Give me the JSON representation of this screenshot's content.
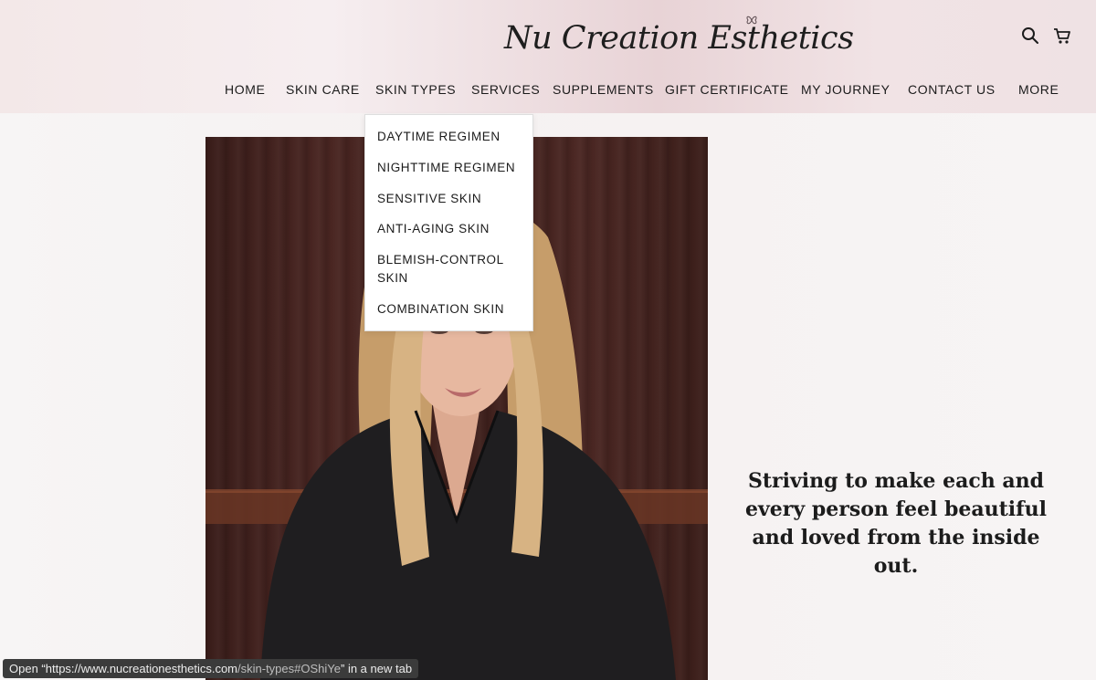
{
  "brand": {
    "logo_text": "Nu Creation Esthetics"
  },
  "header": {
    "icons": [
      "search-icon",
      "cart-icon"
    ]
  },
  "nav": {
    "items": [
      {
        "label": "HOME"
      },
      {
        "label": "SKIN CARE"
      },
      {
        "label": "SKIN TYPES"
      },
      {
        "label": "SERVICES"
      },
      {
        "label": "SUPPLEMENTS"
      },
      {
        "label": "GIFT CERTIFICATE"
      },
      {
        "label": "MY JOURNEY"
      },
      {
        "label": "CONTACT US"
      },
      {
        "label": "MORE"
      }
    ]
  },
  "dropdown": {
    "items": [
      {
        "label": "DAYTIME REGIMEN"
      },
      {
        "label": "NIGHTTIME REGIMEN"
      },
      {
        "label": "SENSITIVE SKIN"
      },
      {
        "label": "ANTI-AGING SKIN"
      },
      {
        "label": "BLEMISH-CONTROL SKIN"
      },
      {
        "label": "COMBINATION SKIN"
      }
    ]
  },
  "hero": {
    "tagline": "Striving to make each and every person feel beautiful and loved from the inside out."
  },
  "statusbar": {
    "prefix": "Open “",
    "url_host": "https://www.nucreationesthetics.com",
    "url_path": "/skin-types#OShiYe",
    "suffix": "” in a new tab"
  },
  "colors": {
    "header_pink": "#e8d3d6",
    "wood": "#4a2622",
    "shirt": "#1f1e20",
    "hair": "#caa373"
  }
}
